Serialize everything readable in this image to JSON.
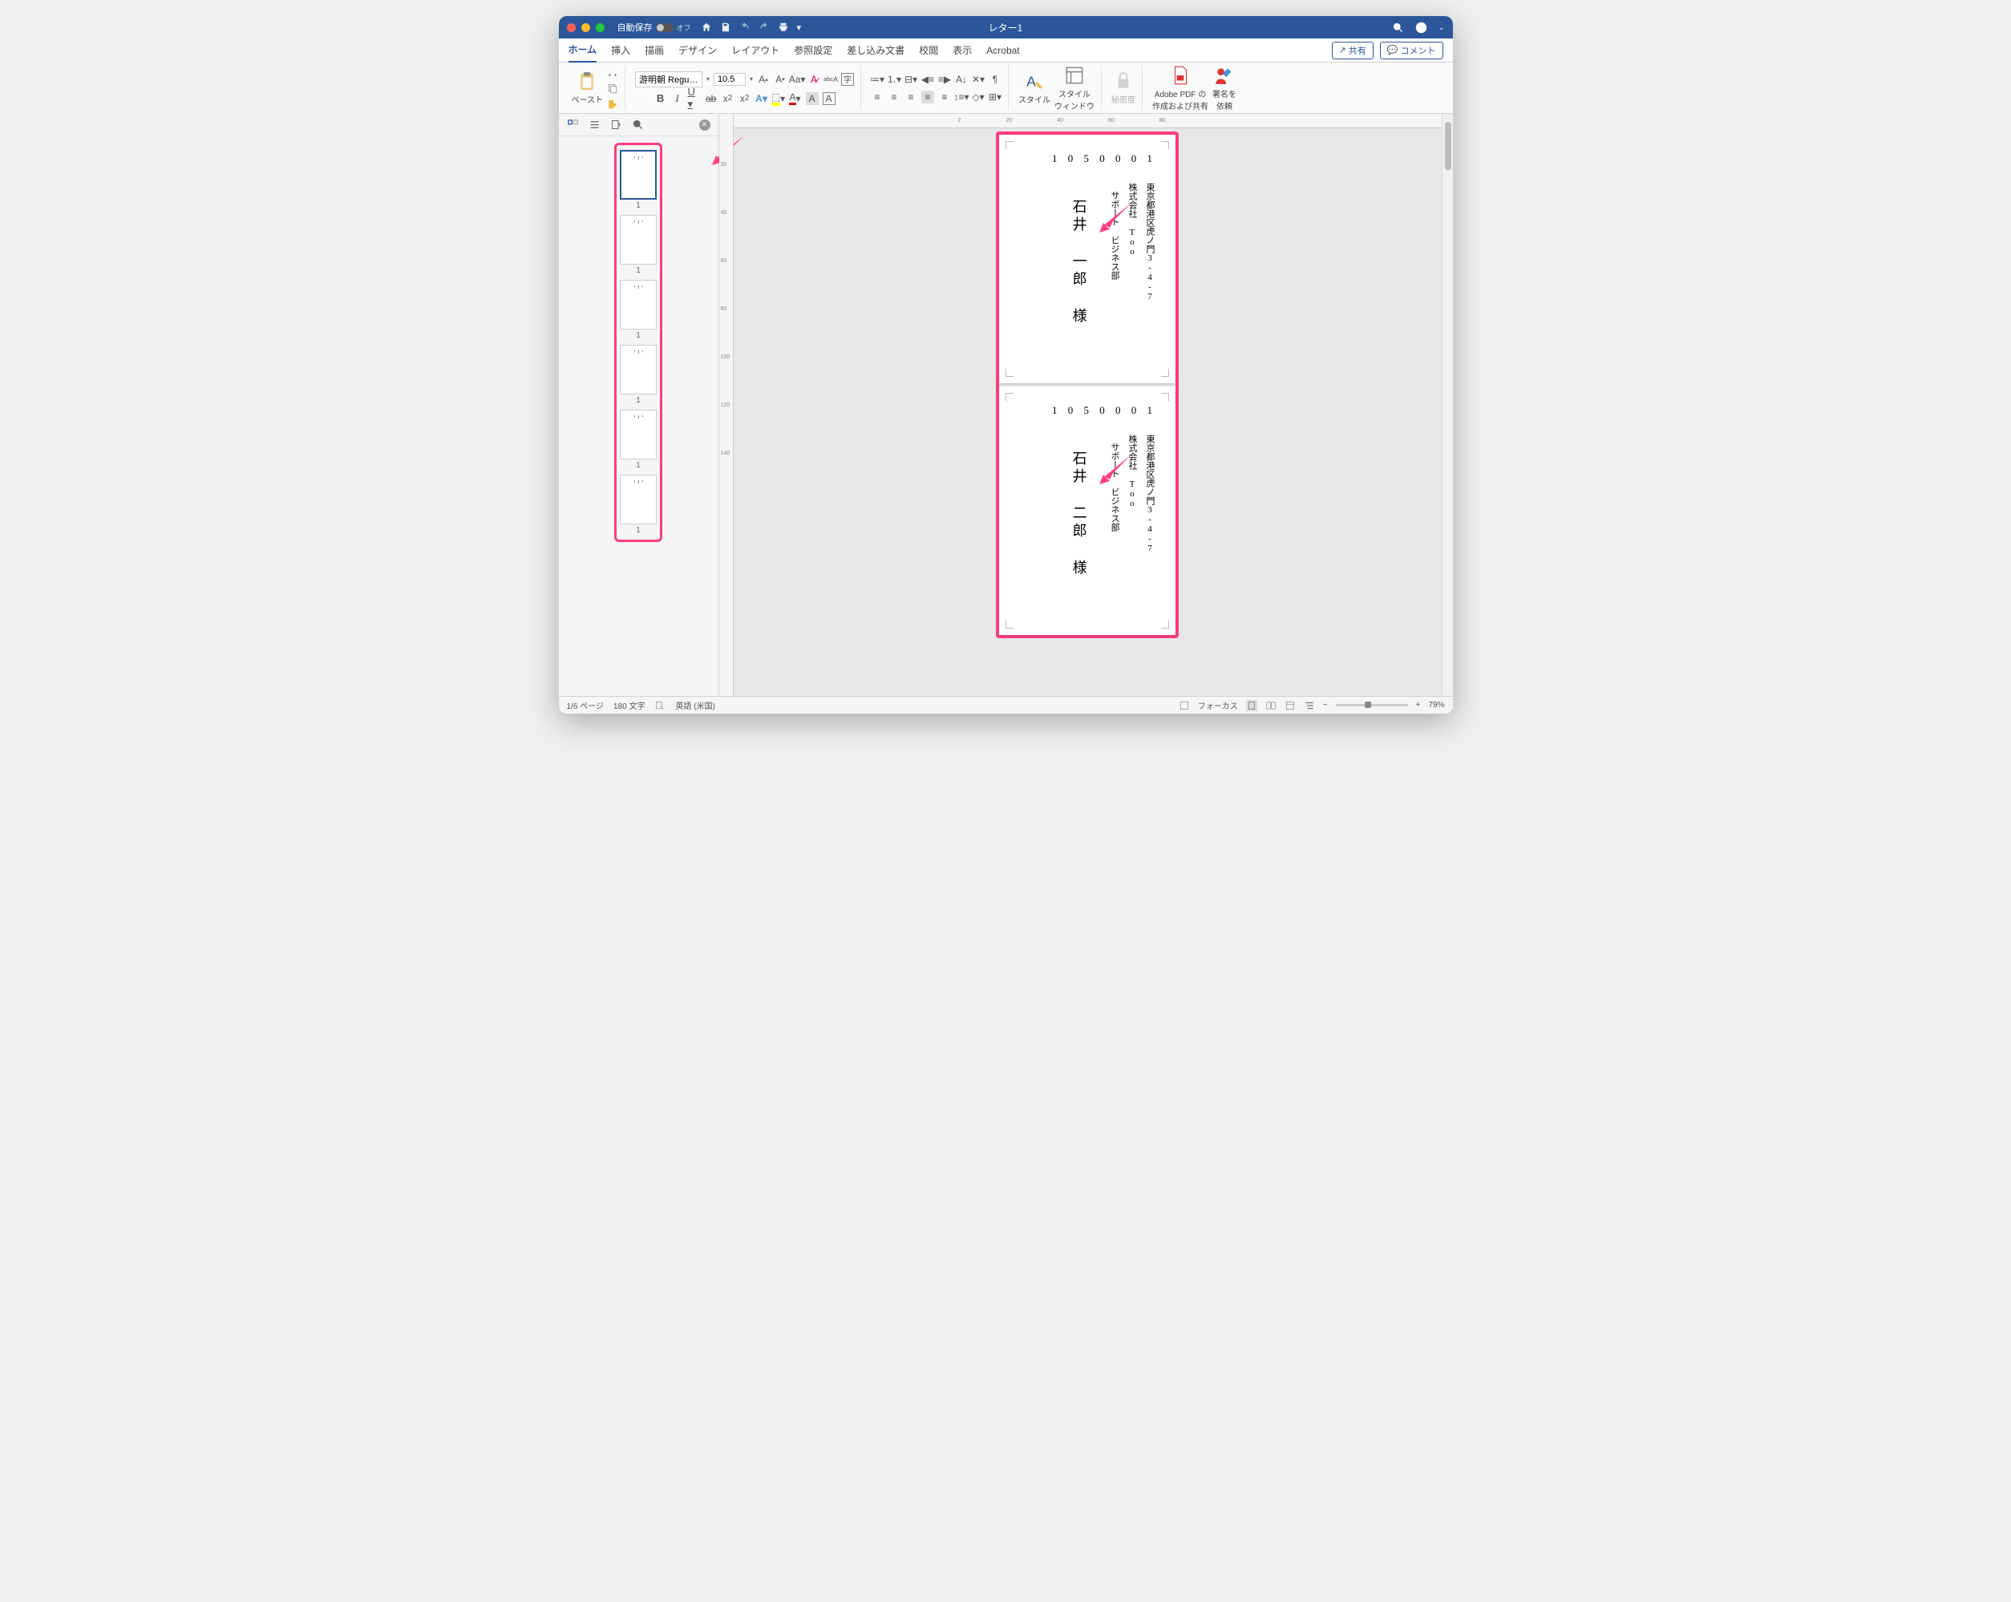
{
  "titlebar": {
    "autosave_label": "自動保存",
    "autosave_state": "オフ",
    "document_title": "レター1"
  },
  "tabs": {
    "items": [
      "ホーム",
      "挿入",
      "描画",
      "デザイン",
      "レイアウト",
      "参照設定",
      "差し込み文書",
      "校閲",
      "表示",
      "Acrobat"
    ],
    "active": 0,
    "share": "共有",
    "comment": "コメント"
  },
  "ribbon": {
    "paste": "ペースト",
    "font_name": "游明朝 Regu…",
    "font_size": "10.5",
    "style": "スタイル",
    "style_window": "スタイル\nウィンドウ",
    "sensitivity": "秘密度",
    "adobe": "Adobe PDF の\n作成および共有",
    "sign": "署名を\n依頼"
  },
  "ruler_h": [
    "2",
    "",
    "20",
    "40",
    "60",
    "80"
  ],
  "ruler_v": [
    "20",
    "40",
    "60",
    "80",
    "100",
    "120",
    "140",
    "20",
    "40"
  ],
  "thumbnails": {
    "count": 6,
    "label": "1"
  },
  "documents": [
    {
      "postal": "1 0 5 0 0 0 1",
      "address1": "東京都港区虎ノ門3-4-7",
      "address2": "株式会社 Too",
      "address3": "サポート ビジネス部",
      "name": "石井 一郎 様"
    },
    {
      "postal": "1 0 5 0 0 0 1",
      "address1": "東京都港区虎ノ門3-4-7",
      "address2": "株式会社 Too",
      "address3": "サポート ビジネス部",
      "name": "石井 二郎 様"
    }
  ],
  "statusbar": {
    "page": "1/6 ページ",
    "words": "180 文字",
    "lang": "英語 (米国)",
    "focus": "フォーカス",
    "zoom": "79%"
  }
}
